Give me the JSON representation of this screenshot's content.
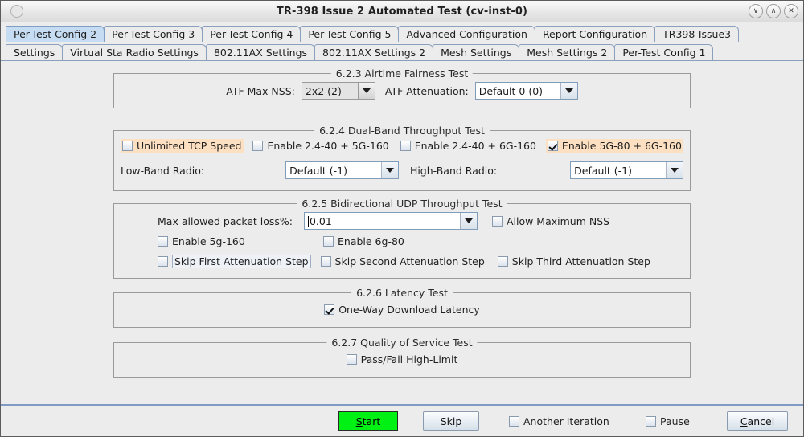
{
  "window": {
    "title": "TR-398 Issue 2 Automated Test  (cv-inst-0)",
    "minimize_glyph": "∨",
    "maximize_glyph": "∧",
    "close_glyph": "✕"
  },
  "tabs": {
    "row1": [
      {
        "label": "Per-Test Config 2",
        "selected": true
      },
      {
        "label": "Per-Test Config 3",
        "selected": false
      },
      {
        "label": "Per-Test Config 4",
        "selected": false
      },
      {
        "label": "Per-Test Config 5",
        "selected": false
      },
      {
        "label": "Advanced Configuration",
        "selected": false
      },
      {
        "label": "Report Configuration",
        "selected": false
      },
      {
        "label": "TR398-Issue3",
        "selected": false
      }
    ],
    "row2": [
      {
        "label": "Settings",
        "selected": false
      },
      {
        "label": "Virtual Sta Radio Settings",
        "selected": false
      },
      {
        "label": "802.11AX Settings",
        "selected": false
      },
      {
        "label": "802.11AX Settings 2",
        "selected": false
      },
      {
        "label": "Mesh Settings",
        "selected": false
      },
      {
        "label": "Mesh Settings 2",
        "selected": false
      },
      {
        "label": "Per-Test Config 1",
        "selected": false
      }
    ]
  },
  "airtime": {
    "legend": "6.2.3 Airtime Fairness Test",
    "nss_label": "ATF Max NSS:",
    "nss_value": "2x2 (2)",
    "atten_label": "ATF Attenuation:",
    "atten_value": "Default 0 (0)"
  },
  "dualband": {
    "legend": "6.2.4 Dual-Band Throughput Test",
    "unlimited_tcp": {
      "label": "Unlimited TCP Speed",
      "checked": false,
      "highlighted": true
    },
    "en_24_5g160": {
      "label": "Enable 2.4-40 + 5G-160",
      "checked": false,
      "highlighted": false
    },
    "en_24_6g160": {
      "label": "Enable 2.4-40 + 6G-160",
      "checked": false,
      "highlighted": false
    },
    "en_5g80_6g160": {
      "label": "Enable 5G-80  + 6G-160",
      "checked": true,
      "highlighted": true
    },
    "low_band_label": "Low-Band Radio:",
    "low_band_value": "Default (-1)",
    "high_band_label": "High-Band Radio:",
    "high_band_value": "Default (-1)"
  },
  "udp": {
    "legend": "6.2.5 Bidirectional UDP Throughput Test",
    "loss_label": "Max allowed packet loss%:",
    "loss_value": "0.01",
    "allow_max_nss": {
      "label": "Allow Maximum NSS",
      "checked": false
    },
    "enable_5g160": {
      "label": "Enable 5g-160",
      "checked": false
    },
    "enable_6g80": {
      "label": "Enable 6g-80",
      "checked": false
    },
    "skip_first": {
      "label": "Skip First Attenuation Step",
      "checked": false,
      "focused": true
    },
    "skip_second": {
      "label": "Skip Second Attenuation Step",
      "checked": false
    },
    "skip_third": {
      "label": "Skip Third Attenuation Step",
      "checked": false
    }
  },
  "latency": {
    "legend": "6.2.6 Latency Test",
    "one_way": {
      "label": "One-Way Download Latency",
      "checked": true
    }
  },
  "qos": {
    "legend": "6.2.7 Quality of Service Test",
    "pass_fail": {
      "label": "Pass/Fail High-Limit",
      "checked": false
    }
  },
  "footer": {
    "start": {
      "pre": "",
      "mnemonic": "S",
      "post": "tart"
    },
    "skip": "Skip",
    "another_iteration": {
      "label": "Another Iteration",
      "checked": false
    },
    "pause": {
      "label": "Pause",
      "checked": false
    },
    "cancel": {
      "pre": "",
      "mnemonic": "C",
      "post": "ancel"
    }
  },
  "colors": {
    "highlight": "#fde0c1",
    "tab_selected": "#c6dcf2",
    "start_green": "#00f113",
    "window_bg": "#ececec"
  }
}
